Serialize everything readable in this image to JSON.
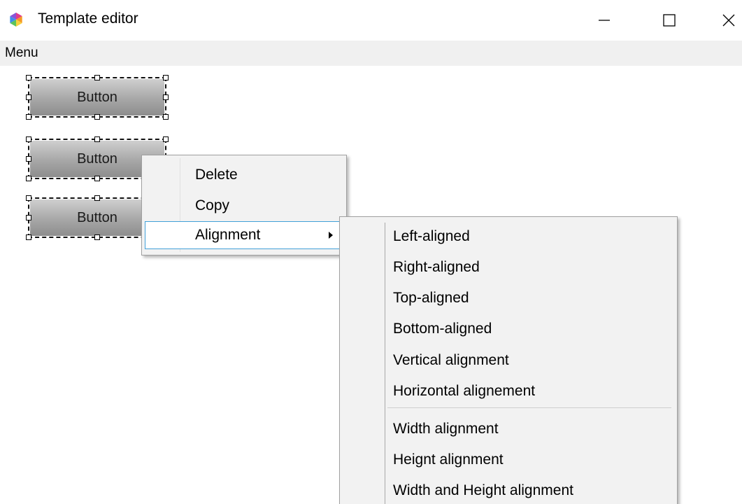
{
  "window": {
    "title": "Template editor",
    "icon": "colorful-hexagon-icon"
  },
  "menubar": {
    "menu_label": "Menu"
  },
  "canvas": {
    "buttons": [
      {
        "label": "Button"
      },
      {
        "label": "Button"
      },
      {
        "label": "Button"
      }
    ]
  },
  "context_menu": {
    "items": [
      {
        "label": "Delete"
      },
      {
        "label": "Copy"
      },
      {
        "label": "Alignment",
        "has_submenu": true,
        "highlighted": true
      }
    ]
  },
  "submenu": {
    "items": [
      {
        "label": "Left-aligned"
      },
      {
        "label": "Right-aligned"
      },
      {
        "label": "Top-aligned"
      },
      {
        "label": "Bottom-aligned"
      },
      {
        "label": "Vertical alignment"
      },
      {
        "label": "Horizontal alignement"
      },
      {
        "label": "Width alignment"
      },
      {
        "label": "Heignt alignment"
      },
      {
        "label": "Width and Height alignment"
      }
    ]
  },
  "colors": {
    "highlight_border": "#42a0d8",
    "menu_background": "#f2f2f2",
    "menubar_background": "#f0f0f0"
  }
}
